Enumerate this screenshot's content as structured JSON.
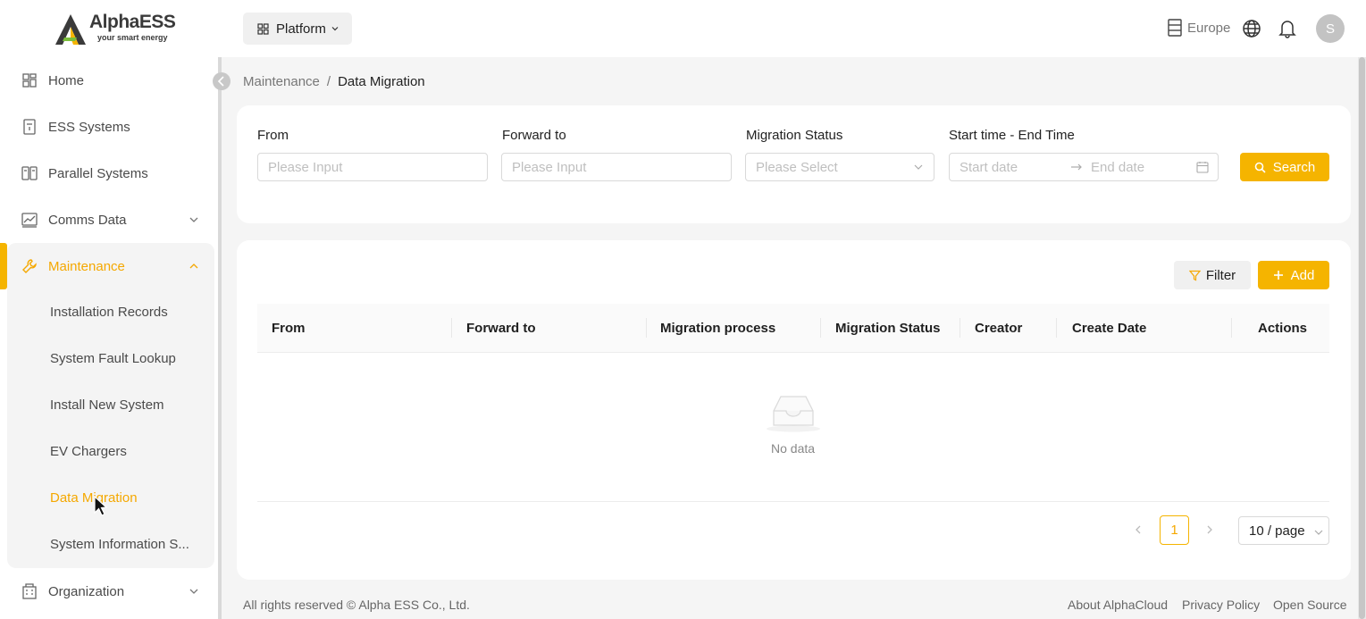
{
  "brand": {
    "name": "AlphaESS",
    "tagline": "your smart energy"
  },
  "sidebar": {
    "items": [
      {
        "label": "Home",
        "icon": "dashboard-icon"
      },
      {
        "label": "ESS Systems",
        "icon": "battery-icon"
      },
      {
        "label": "Parallel Systems",
        "icon": "parallel-icon"
      },
      {
        "label": "Comms Data",
        "icon": "chart-icon",
        "expanded": false
      },
      {
        "label": "Maintenance",
        "icon": "wrench-icon",
        "expanded": true,
        "active": true
      },
      {
        "label": "Organization",
        "icon": "building-icon",
        "expanded": false
      }
    ],
    "maintenance_subitems": [
      {
        "label": "Installation Records"
      },
      {
        "label": "System Fault Lookup"
      },
      {
        "label": "Install New System"
      },
      {
        "label": "EV Chargers"
      },
      {
        "label": "Data Migration",
        "active": true
      },
      {
        "label": "System Information S..."
      }
    ]
  },
  "topbar": {
    "platform_label": "Platform",
    "region_label": "Europe",
    "avatar_initial": "S"
  },
  "breadcrumb": {
    "parent": "Maintenance",
    "separator": "/",
    "current": "Data Migration"
  },
  "search_form": {
    "from": {
      "label": "From",
      "placeholder": "Please Input"
    },
    "forward_to": {
      "label": "Forward to",
      "placeholder": "Please Input"
    },
    "status": {
      "label": "Migration Status",
      "placeholder": "Please Select"
    },
    "time_range": {
      "label": "Start time - End Time",
      "start_placeholder": "Start date",
      "end_placeholder": "End date"
    },
    "search_label": "Search"
  },
  "table": {
    "filter_label": "Filter",
    "add_label": "Add",
    "columns": [
      "From",
      "Forward to",
      "Migration process",
      "Migration Status",
      "Creator",
      "Create Date",
      "Actions"
    ],
    "rows": [],
    "empty_text": "No data"
  },
  "pagination": {
    "current_page": "1",
    "page_size": "10 / page"
  },
  "footer": {
    "copyright": "All rights reserved © Alpha ESS Co., Ltd.",
    "links": [
      "About AlphaCloud",
      "Privacy Policy",
      "Open Source"
    ]
  },
  "colors": {
    "accent": "#f5b400",
    "accent_text": "#f5a800"
  }
}
